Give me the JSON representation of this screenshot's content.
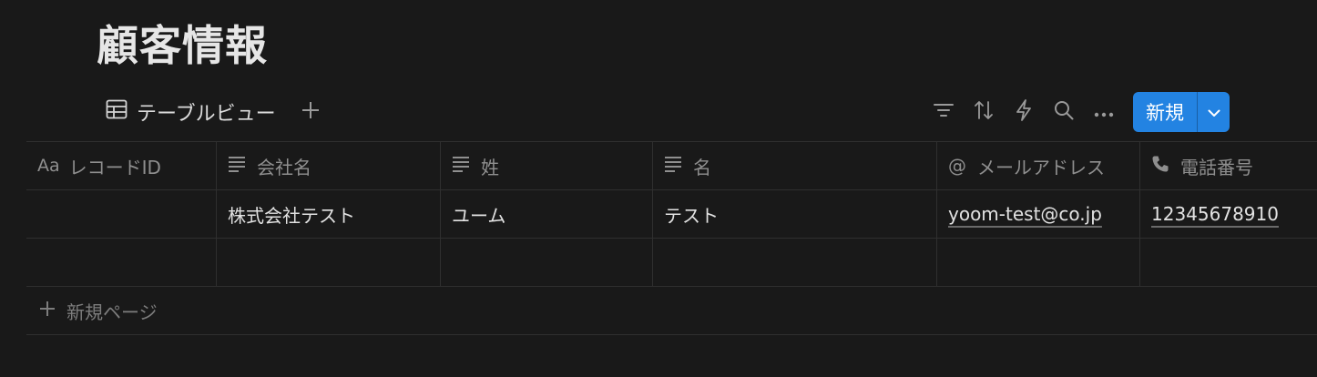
{
  "page": {
    "title": "顧客情報"
  },
  "view": {
    "tab_label": "テーブルビュー",
    "table_icon": "table-icon",
    "add_icon": "plus-icon"
  },
  "toolbar": {
    "icons": [
      "filter-icon",
      "sort-icon",
      "automation-icon",
      "search-icon",
      "more-icon"
    ],
    "new_label": "新規",
    "new_caret_icon": "chevron-down-icon"
  },
  "table": {
    "columns": [
      {
        "icon": "title-icon",
        "icon_text": "Aa",
        "label": "レコードID"
      },
      {
        "icon": "text-lines-icon",
        "label": "会社名"
      },
      {
        "icon": "text-lines-icon",
        "label": "姓"
      },
      {
        "icon": "text-lines-icon",
        "label": "名"
      },
      {
        "icon": "at-icon",
        "icon_text": "@",
        "label": "メールアドレス"
      },
      {
        "icon": "phone-icon",
        "label": "電話番号"
      }
    ],
    "rows": [
      [
        "",
        "株式会社テスト",
        "ユーム",
        "テスト",
        "yoom-test@co.jp",
        "12345678910"
      ],
      [
        "",
        "",
        "",
        "",
        "",
        ""
      ]
    ],
    "new_page_label": "新規ページ"
  },
  "colors": {
    "accent": "#2383e2",
    "background": "#191919"
  }
}
